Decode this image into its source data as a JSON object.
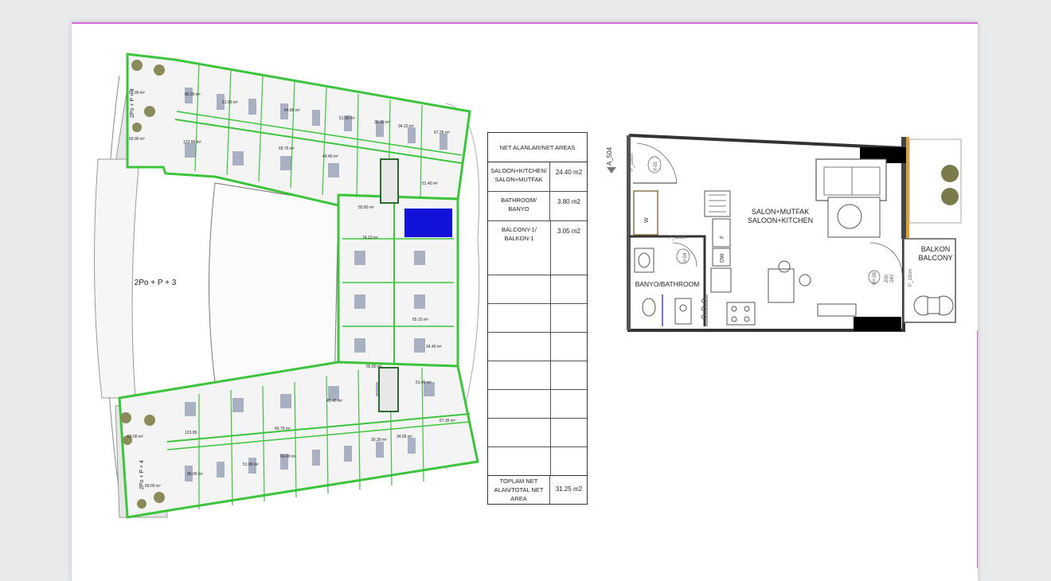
{
  "site_plan": {
    "block_label": "2Po + P + 3",
    "side_label_top": "2Po + P + 4",
    "side_label_bottom": "2Po + P + 4",
    "unit_areas_top": [
      "86.90 m²",
      "51.90 m²",
      "64.80 m²",
      "51.90 m²",
      "30.30 m²",
      "34.10 m²",
      "67.35 m²"
    ],
    "unit_areas_mid": [
      "123.95 m²",
      "65.75 m²",
      "49.40 m²",
      "55.80 m²",
      "51.40 m²",
      "74.10 m²",
      "65.10 m²",
      "34.40 m²"
    ],
    "unit_areas_bottom": [
      "123.95",
      "65.75 m²",
      "49.40 m²",
      "55.80 m²",
      "51.40 m²",
      "67.35 m²",
      "34.05 m²",
      "30.30 m²",
      "64.80 m²",
      "51.90 m²",
      "86.90 m²"
    ],
    "terrace_areas": [
      "69.00 m²",
      "69.00 m²",
      "69.00 m²",
      "69.00 m²"
    ]
  },
  "table": {
    "header": "NET ALANLAR/NET AREAS",
    "rows": [
      {
        "label_line1": "SALOON+KITCHEN/",
        "label_line2": "SALON+MUTFAK",
        "value": "24.40 m2"
      },
      {
        "label_line1": "BATHROOM/",
        "label_line2": "BANYO",
        "value": "3.80 m2"
      },
      {
        "label_line1": "BALCONY-1/",
        "label_line2": "BALKON-1",
        "value": "3.05 m2"
      }
    ],
    "total_line1": "TOPLAM NET",
    "total_line2": "ALAN/TOTAL NET",
    "total_line3": "AREA",
    "total_value": "31.25 m2"
  },
  "floor_plan": {
    "section_mark": "A_504",
    "room_living_1": "SALON+MUTFAK",
    "room_living_2": "SALOON+KITCHEN",
    "room_bath": "BANYO/BATHROOM",
    "room_balcony_1": "BALKON",
    "room_balcony_2": "BALCONY",
    "door_tag_1": "V-01",
    "door_tag_2": "V-04",
    "door_tag_3": "BY-05",
    "dims_1": "P_10cm",
    "dims_2": "P_10cm",
    "dims_3": "P_10cm",
    "dims_4": "200",
    "dims_5": "240",
    "appliance_w": "W",
    "appliance_f": "F",
    "appliance_dw": "DW"
  },
  "colors": {
    "accent_line": "#d36ad8",
    "plan_green": "#3cc43c",
    "highlight_blue": "#1212d8",
    "balcony_strip": "#e0a030"
  }
}
